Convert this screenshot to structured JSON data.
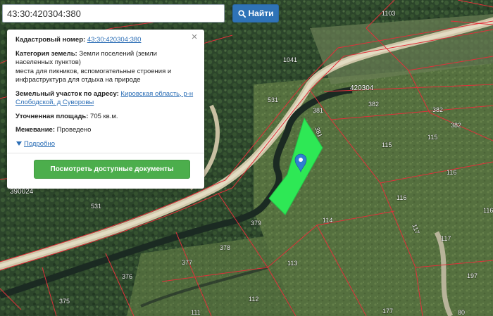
{
  "search": {
    "value": "43:30:420304:380",
    "button_label": "Найти"
  },
  "info": {
    "cadastral_label": "Кадастровый номер:",
    "cadastral_value": "43:30:420304:380",
    "category_label": "Категория земель:",
    "category_value": "Земли поселений (земли населенных пунктов)",
    "category_use": "места для пикников, вспомогательные строения и инфраструктура для отдыха на природе",
    "address_label": "Земельный участок по адресу:",
    "address_value": "Кировская область, р-н Слободской, д Суворовы",
    "area_label": "Уточненная площадь:",
    "area_value": "705 кв.м.",
    "survey_label": "Межевание:",
    "survey_value": "Проведено",
    "details_link": "Подробно",
    "close_symbol": "×",
    "documents_button": "Посмотреть доступные документы"
  },
  "map": {
    "block_label": "420304",
    "neighbor_block_label": "390024",
    "parcel_labels": [
      "1103",
      "1041",
      "531",
      "381",
      "381",
      "382",
      "382",
      "382",
      "115",
      "115",
      "116",
      "116",
      "116",
      "531",
      "379",
      "114",
      "117",
      "117",
      "378",
      "377",
      "113",
      "376",
      "197",
      "375",
      "112",
      "111",
      "177",
      "80"
    ],
    "colors": {
      "boundary": "#e0303a",
      "selected_parcel": "#2ee855",
      "marker": "#2f7fd1"
    }
  }
}
